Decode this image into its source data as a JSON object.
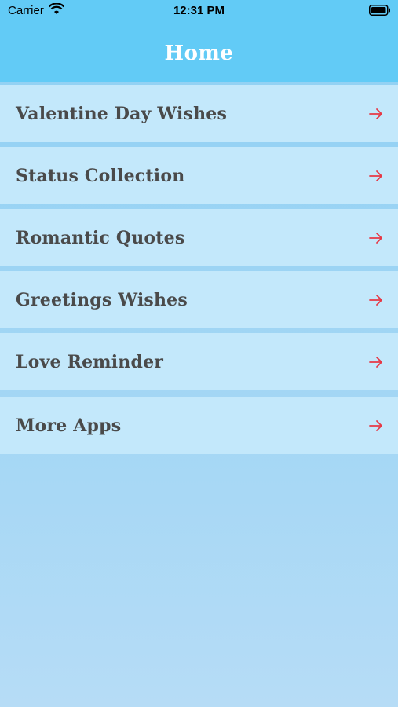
{
  "status_bar": {
    "carrier": "Carrier",
    "time": "12:31 PM",
    "icons": [
      "wifi-icon",
      "battery-icon"
    ]
  },
  "nav": {
    "title": "Home"
  },
  "menu": {
    "items": [
      {
        "label": "Valentine Day Wishes",
        "icon": "arrow-right-icon"
      },
      {
        "label": "Status Collection",
        "icon": "arrow-right-icon"
      },
      {
        "label": "Romantic Quotes",
        "icon": "arrow-right-icon"
      },
      {
        "label": "Greetings Wishes",
        "icon": "arrow-right-icon"
      },
      {
        "label": "Love Reminder",
        "icon": "arrow-right-icon"
      },
      {
        "label": "More Apps",
        "icon": "arrow-right-icon"
      }
    ]
  },
  "colors": {
    "header": "#62cbf6",
    "item_background": "#c3e8fb",
    "separator": "#7fcdf2",
    "arrow": "#e63946",
    "label": "#4a4a4a"
  }
}
